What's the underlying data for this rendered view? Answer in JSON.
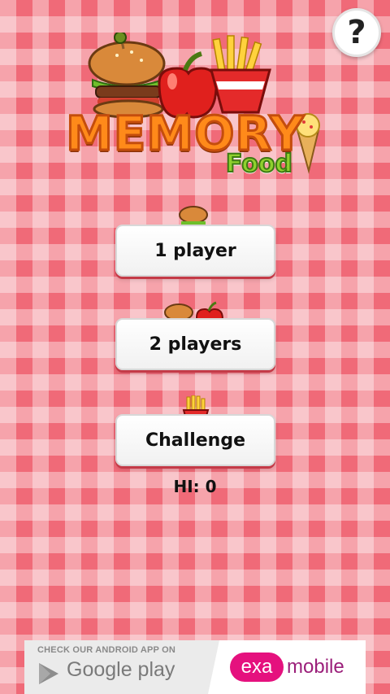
{
  "help": {
    "label": "?"
  },
  "logo": {
    "title": "MEMORY",
    "subtitle": "Food"
  },
  "menu": {
    "one_player": "1 player",
    "two_players": "2 players",
    "challenge": "Challenge"
  },
  "hi_score": "HI: 0",
  "ad": {
    "check_text": "CHECK OUR ANDROID APP ON",
    "google_play": "Google play",
    "exa": "exa",
    "mobile": "mobile"
  },
  "colors": {
    "checker_red": "#f06a78",
    "logo_orange": "#ff8a1a",
    "logo_green": "#8fd12e",
    "exa_pink": "#e5117e"
  },
  "icons": [
    "question-icon",
    "burger-icon",
    "apple-icon",
    "fries-icon",
    "ice-cream-icon",
    "google-play-icon"
  ]
}
